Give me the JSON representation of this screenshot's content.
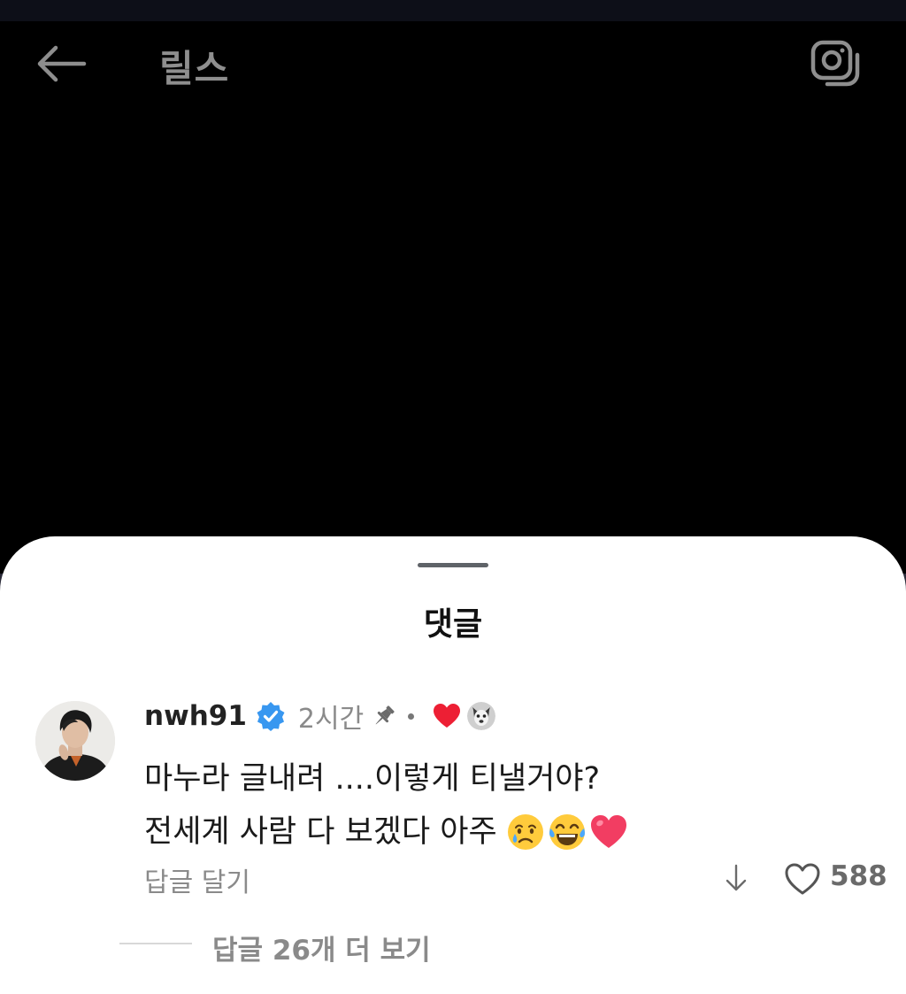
{
  "header": {
    "title": "릴스",
    "back_icon": "arrow-left-icon",
    "camera_icon": "camera-icon"
  },
  "comments_sheet": {
    "title": "댓글"
  },
  "comment": {
    "username": "nwh91",
    "verified": true,
    "time": "2시간",
    "pinned": true,
    "liked_by_creator": true,
    "text_line1": "마누라 글내려 ....이렇게 티낼거야?",
    "text_line2": "전세계 사람 다 보겠다 아주",
    "emojis": [
      "crying-face",
      "tears-of-joy-face",
      "red-heart"
    ],
    "reply_label": "답글 달기",
    "like_count": "588",
    "view_replies_label": "답글 26개 더 보기"
  },
  "colors": {
    "verified_badge": "#3897f0",
    "heart_red": "#ed1f34",
    "muted_text": "#8a8a8a"
  }
}
